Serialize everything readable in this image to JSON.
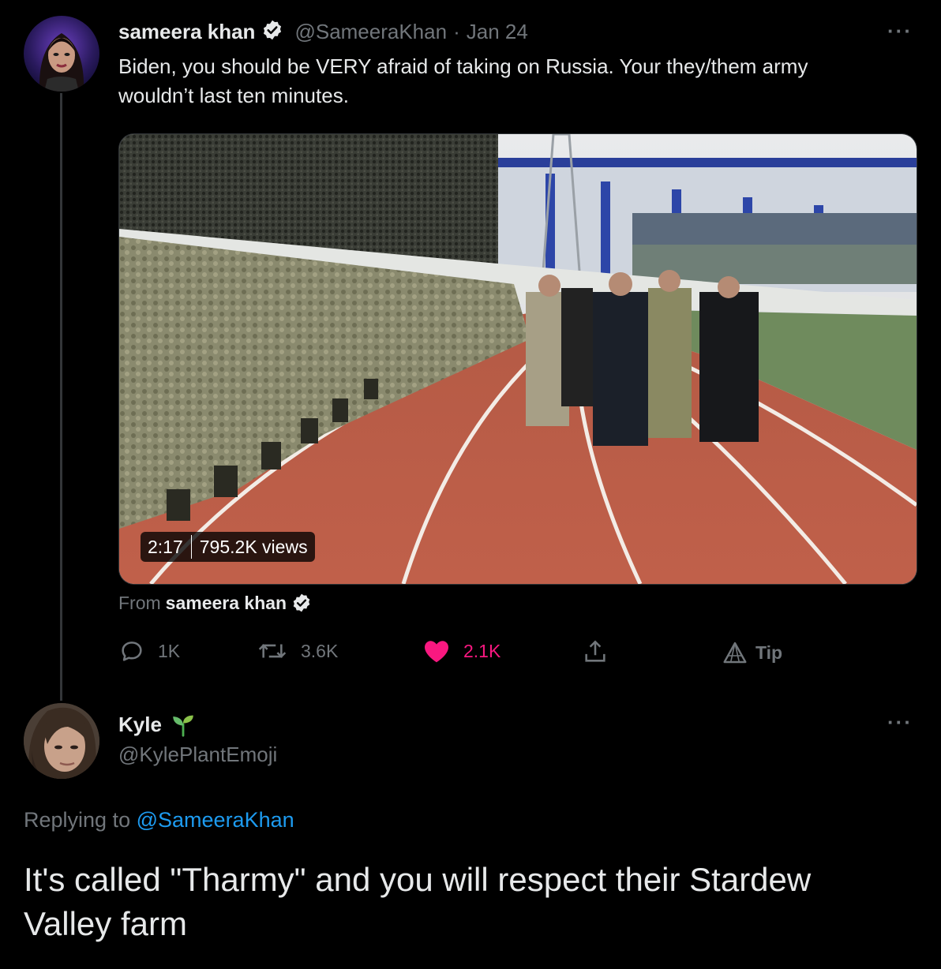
{
  "main_tweet": {
    "display_name": "sameera khan",
    "handle": "@SameeraKhan",
    "date": "Jan 24",
    "more": "···",
    "text_line1": "Biden, you should be VERY afraid of taking on Russia. Your they/them army",
    "text_line2": "wouldn’t last ten minutes.",
    "video": {
      "duration": "2:17",
      "views": "795.2K views"
    },
    "from_prefix": "From",
    "from_name": "sameera khan",
    "actions": {
      "reply_count": "1K",
      "retweet_count": "3.6K",
      "like_count": "2.1K",
      "tip_label": "Tip"
    }
  },
  "reply_tweet": {
    "display_name": "Kyle",
    "name_emoji": "seedling-icon",
    "handle": "@KylePlantEmoji",
    "more": "···",
    "replying_prefix": "Replying to",
    "replying_handle": "@SameeraKhan",
    "text_line1": "It's called \"Tharmy\" and you will respect their Stardew",
    "text_line2": "Valley farm"
  },
  "colors": {
    "background": "#000000",
    "text": "#e7e9ea",
    "muted": "#71767b",
    "link": "#1d9bf0",
    "like": "#f91880",
    "verified": "#ffffff",
    "seedling": "#4caf50"
  }
}
